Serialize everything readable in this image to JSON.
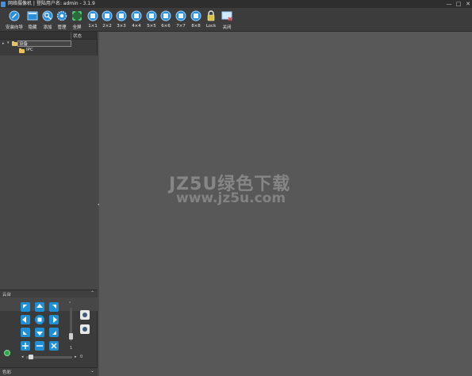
{
  "window": {
    "title": "网络摄像机 | 登陆用户名: admin - 3.1.9",
    "controls": {
      "minimize": "—",
      "maximize": "□",
      "close": "✕"
    }
  },
  "toolbar": {
    "items": [
      {
        "label": "安装向导",
        "icon": "wizard-icon"
      },
      {
        "label": "隐藏",
        "icon": "hide-icon"
      },
      {
        "label": "添加",
        "icon": "add-icon"
      },
      {
        "label": "管理",
        "icon": "manage-icon"
      },
      {
        "label": "全屏",
        "icon": "fullscreen-icon"
      },
      {
        "label": "1×1",
        "icon": "layout-icon"
      },
      {
        "label": "2×2",
        "icon": "layout-icon"
      },
      {
        "label": "3×3",
        "icon": "layout-icon"
      },
      {
        "label": "4×4",
        "icon": "layout-icon"
      },
      {
        "label": "5×5",
        "icon": "layout-icon"
      },
      {
        "label": "6×6",
        "icon": "layout-icon"
      },
      {
        "label": "7×7",
        "icon": "layout-icon"
      },
      {
        "label": "8×8",
        "icon": "layout-icon"
      },
      {
        "label": "Lock",
        "icon": "lock-icon"
      },
      {
        "label": "关闭",
        "icon": "close-screen-icon"
      }
    ]
  },
  "device_tree": {
    "column_status": "状态",
    "root": {
      "label": "设备"
    },
    "child": {
      "label": "IPC"
    }
  },
  "ptz": {
    "title": "云台",
    "speed_value": "1",
    "zoom_value": "0"
  },
  "color": {
    "title": "色彩"
  },
  "watermark": {
    "line1": "JZ5U绿色下载",
    "line2": "www.jz5u.com"
  },
  "colors": {
    "accent_blue": "#1f8fd6",
    "background": "#585858",
    "panel": "#3b3b3b"
  }
}
